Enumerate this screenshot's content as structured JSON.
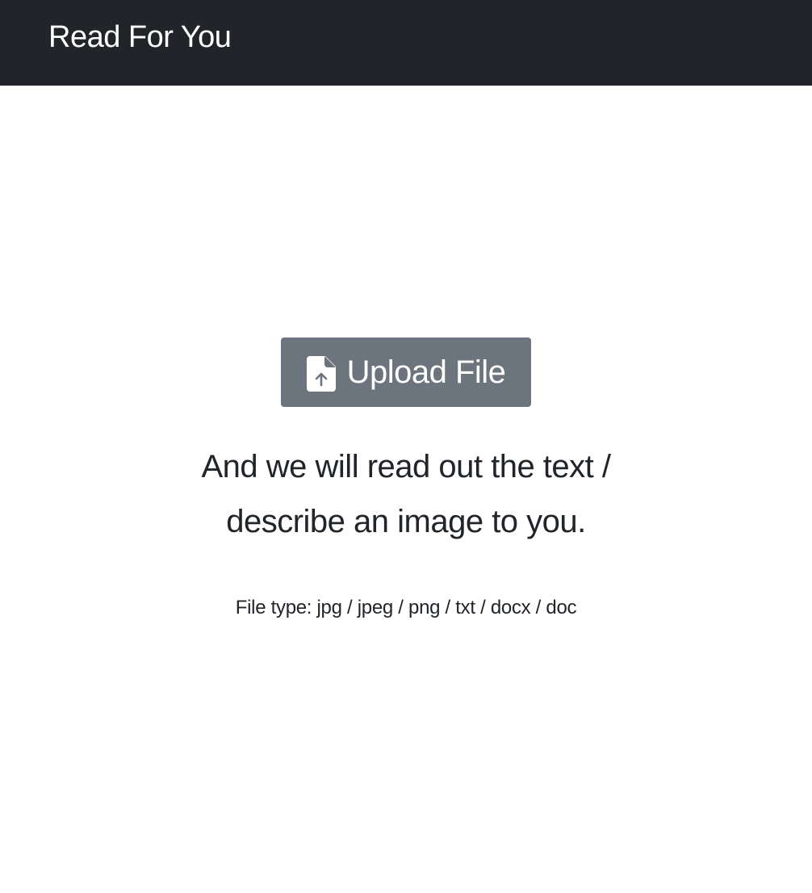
{
  "navbar": {
    "brand": "Read For You"
  },
  "upload": {
    "icon": "file-upload-icon",
    "label": "Upload File",
    "button_color": "#6c757d"
  },
  "tagline": {
    "line1": "And we will read out the text /",
    "line2": "describe an image to you."
  },
  "file_types": "File type: jpg / jpeg / png / txt / docx / doc",
  "colors": {
    "navbar_bg": "#212529",
    "text": "#212529",
    "background": "#ffffff"
  }
}
